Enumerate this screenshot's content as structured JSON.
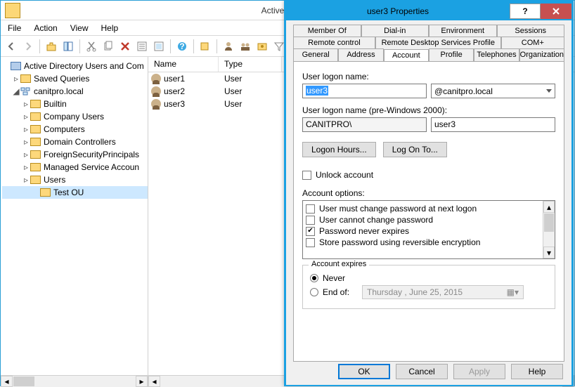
{
  "mainWindow": {
    "title": "Active Directory Use",
    "menus": [
      "File",
      "Action",
      "View",
      "Help"
    ],
    "tree": {
      "root": "Active Directory Users and Com",
      "savedQueries": "Saved Queries",
      "domain": "canitpro.local",
      "children": [
        "Builtin",
        "Company Users",
        "Computers",
        "Domain Controllers",
        "ForeignSecurityPrincipals",
        "Managed Service Accoun",
        "Users",
        "Test OU"
      ]
    },
    "list": {
      "cols": {
        "name": "Name",
        "type": "Type"
      },
      "rows": [
        {
          "name": "user1",
          "type": "User"
        },
        {
          "name": "user2",
          "type": "User"
        },
        {
          "name": "user3",
          "type": "User"
        }
      ]
    }
  },
  "dialog": {
    "title": "user3 Properties",
    "tabs": {
      "row1": [
        "Member Of",
        "Dial-in",
        "Environment",
        "Sessions"
      ],
      "row2": [
        "Remote control",
        "Remote Desktop Services Profile",
        "COM+"
      ],
      "row3": [
        "General",
        "Address",
        "Account",
        "Profile",
        "Telephones",
        "Organization"
      ]
    },
    "activeTab": "Account",
    "logonNameLabel": "User logon name:",
    "logonName": "user3",
    "logonSuffix": "@canitpro.local",
    "preWinLabel": "User logon name (pre-Windows 2000):",
    "preWinDomain": "CANITPRO\\",
    "preWinUser": "user3",
    "logonHoursBtn": "Logon Hours...",
    "logOnToBtn": "Log On To...",
    "unlockLabel": "Unlock account",
    "acctOptionsLabel": "Account options:",
    "options": [
      {
        "label": "User must change password at next logon",
        "checked": false
      },
      {
        "label": "User cannot change password",
        "checked": false
      },
      {
        "label": "Password never expires",
        "checked": true
      },
      {
        "label": "Store password using reversible encryption",
        "checked": false
      }
    ],
    "expires": {
      "legend": "Account expires",
      "never": "Never",
      "endOf": "End of:",
      "date": "Thursday ,    June     25, 2015"
    },
    "buttons": {
      "ok": "OK",
      "cancel": "Cancel",
      "apply": "Apply",
      "help": "Help"
    }
  }
}
